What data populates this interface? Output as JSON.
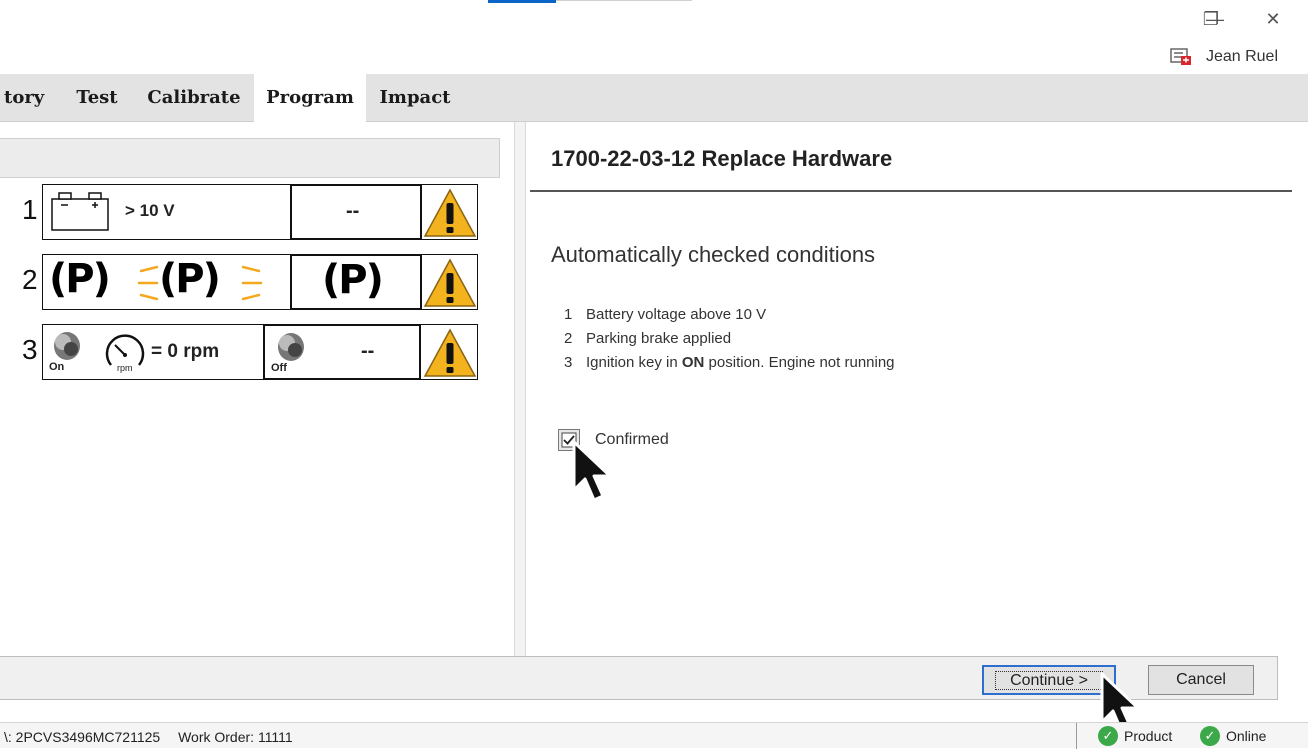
{
  "window": {
    "minimize_glyph": "—",
    "restore_glyph": "❐",
    "close_glyph": "✕",
    "user_icon": "user-card-icon",
    "user_name": "Jean Ruel"
  },
  "tabs": [
    {
      "label": "tory",
      "active": false
    },
    {
      "label": "Test",
      "active": false
    },
    {
      "label": "Calibrate",
      "active": false
    },
    {
      "label": "Program",
      "active": true
    },
    {
      "label": "Impact",
      "active": false
    }
  ],
  "conditions_panel": {
    "rows": [
      {
        "number": "1",
        "requirement_text": "> 10 V",
        "current_value": "--",
        "status_icon": "warning-icon"
      },
      {
        "number": "2",
        "requirement_text": "(P)",
        "current_value": "(P)",
        "status_icon": "warning-icon"
      },
      {
        "number": "3",
        "requirement_text": "= 0 rpm",
        "key_on_label": "On",
        "rpm_label": "rpm",
        "key_off_label": "Off",
        "current_value": "--",
        "status_icon": "warning-icon"
      }
    ]
  },
  "detail": {
    "title": "1700-22-03-12 Replace Hardware",
    "heading": "Automatically checked conditions",
    "conditions": [
      {
        "n": "1",
        "text": "Battery voltage above 10 V"
      },
      {
        "n": "2",
        "text": "Parking brake applied"
      },
      {
        "n": "3",
        "text_before": "Ignition key in ",
        "text_bold": "ON",
        "text_after": " position. Engine not running"
      }
    ],
    "confirm_label": "Confirmed",
    "confirm_checked": true
  },
  "buttons": {
    "continue_label": "Continue >",
    "cancel_label": "Cancel"
  },
  "status_bar": {
    "vin": "\\: 2PCVS3496MC721125",
    "work_order": "Work Order: 11111",
    "product_label": "Product",
    "online_label": "Online"
  },
  "colors": {
    "accent": "#0a64c8",
    "warning": "#f2b31f",
    "ok": "#3ba84a"
  }
}
